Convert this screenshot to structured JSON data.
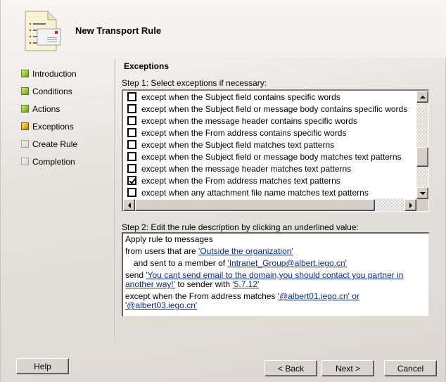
{
  "window": {
    "title": "New Transport Rule"
  },
  "nav": {
    "items": [
      {
        "label": "Introduction",
        "status": "done"
      },
      {
        "label": "Conditions",
        "status": "done"
      },
      {
        "label": "Actions",
        "status": "done"
      },
      {
        "label": "Exceptions",
        "status": "current"
      },
      {
        "label": "Create Rule",
        "status": "pending"
      },
      {
        "label": "Completion",
        "status": "pending"
      }
    ]
  },
  "main": {
    "section_title": "Exceptions",
    "step1_label": "Step 1: Select exceptions if necessary:",
    "exceptions": [
      {
        "label": "except when the Subject field contains specific words",
        "checked": false
      },
      {
        "label": "except when the Subject field or message body contains specific words",
        "checked": false
      },
      {
        "label": "except when the message header contains specific words",
        "checked": false
      },
      {
        "label": "except when the From address contains specific words",
        "checked": false
      },
      {
        "label": "except when the Subject field matches text patterns",
        "checked": false
      },
      {
        "label": "except when the Subject field or message body matches text patterns",
        "checked": false
      },
      {
        "label": "except when the message header matches text patterns",
        "checked": false
      },
      {
        "label": "except when the From address matches text patterns",
        "checked": true
      },
      {
        "label": "except when any attachment file name matches text patterns",
        "checked": false
      }
    ],
    "step2_label": "Step 2: Edit the rule description by clicking an underlined value:",
    "description": {
      "line1": "Apply rule to messages",
      "line2_prefix": "from users that are ",
      "line2_link": "'Outside the organization'",
      "line3_prefix": "and sent to a member of ",
      "line3_link": "'Intranet_Group@albert.iego.cn'",
      "line4_prefix": "send ",
      "line4_link": "'You cant send email to the domain,you should contact you  partner in another way!'",
      "line4_mid": " to sender with ",
      "line4_link2": "'5.7.12'",
      "line5_prefix": "except when the From address matches ",
      "line5_link": "'@albert01.iego.cn' or '@albert03.iego.cn'"
    }
  },
  "buttons": {
    "help": "Help",
    "back": "< Back",
    "next": "Next >",
    "cancel": "Cancel"
  }
}
